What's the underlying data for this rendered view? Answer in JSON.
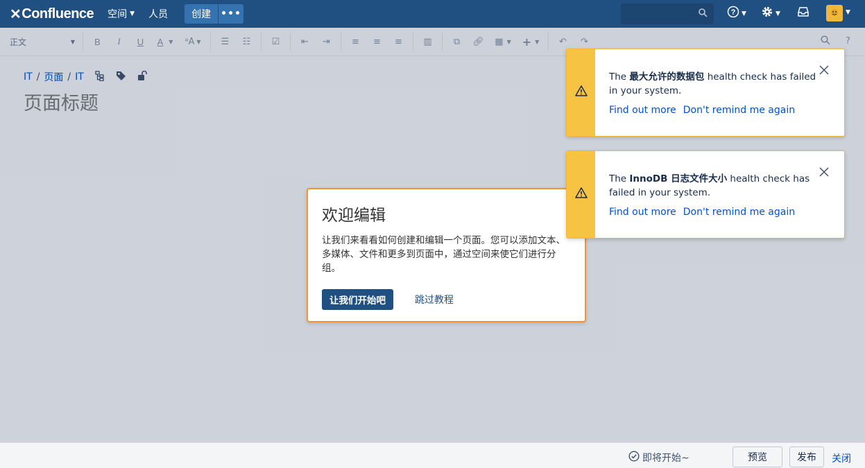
{
  "topnav": {
    "logo": "Confluence",
    "spaces": "空间",
    "people": "人员",
    "create": "创建",
    "more": "•••"
  },
  "toolbar": {
    "style": "正文",
    "bold": "B",
    "italic": "I",
    "underline": "U",
    "color": "A"
  },
  "breadcrumb": [
    "IT",
    "页面",
    "IT"
  ],
  "page_title_placeholder": "页面标题",
  "welcome": {
    "title": "欢迎编辑",
    "text": "让我们来看看如何创建和编辑一个页面。您可以添加文本、多媒体、文件和更多到页面中，通过空间来使它们进行分组。",
    "primary": "让我们开始吧",
    "skip": "跳过教程"
  },
  "flags": [
    {
      "prefix": "The ",
      "bold": "最大允许的数据包",
      "suffix": " health check has failed in your system.",
      "link1": "Find out more",
      "link2": "Don't remind me again"
    },
    {
      "prefix": "The ",
      "bold": "InnoDB 日志文件大小",
      "suffix": " health check has failed in your system.",
      "link1": "Find out more",
      "link2": "Don't remind me again"
    }
  ],
  "bottombar": {
    "status": "即将开始~",
    "preview": "预览",
    "publish": "发布",
    "close": "关闭"
  },
  "colors": {
    "nav": "#205081",
    "warning": "#f6c342",
    "dialog_border": "#f79232"
  }
}
